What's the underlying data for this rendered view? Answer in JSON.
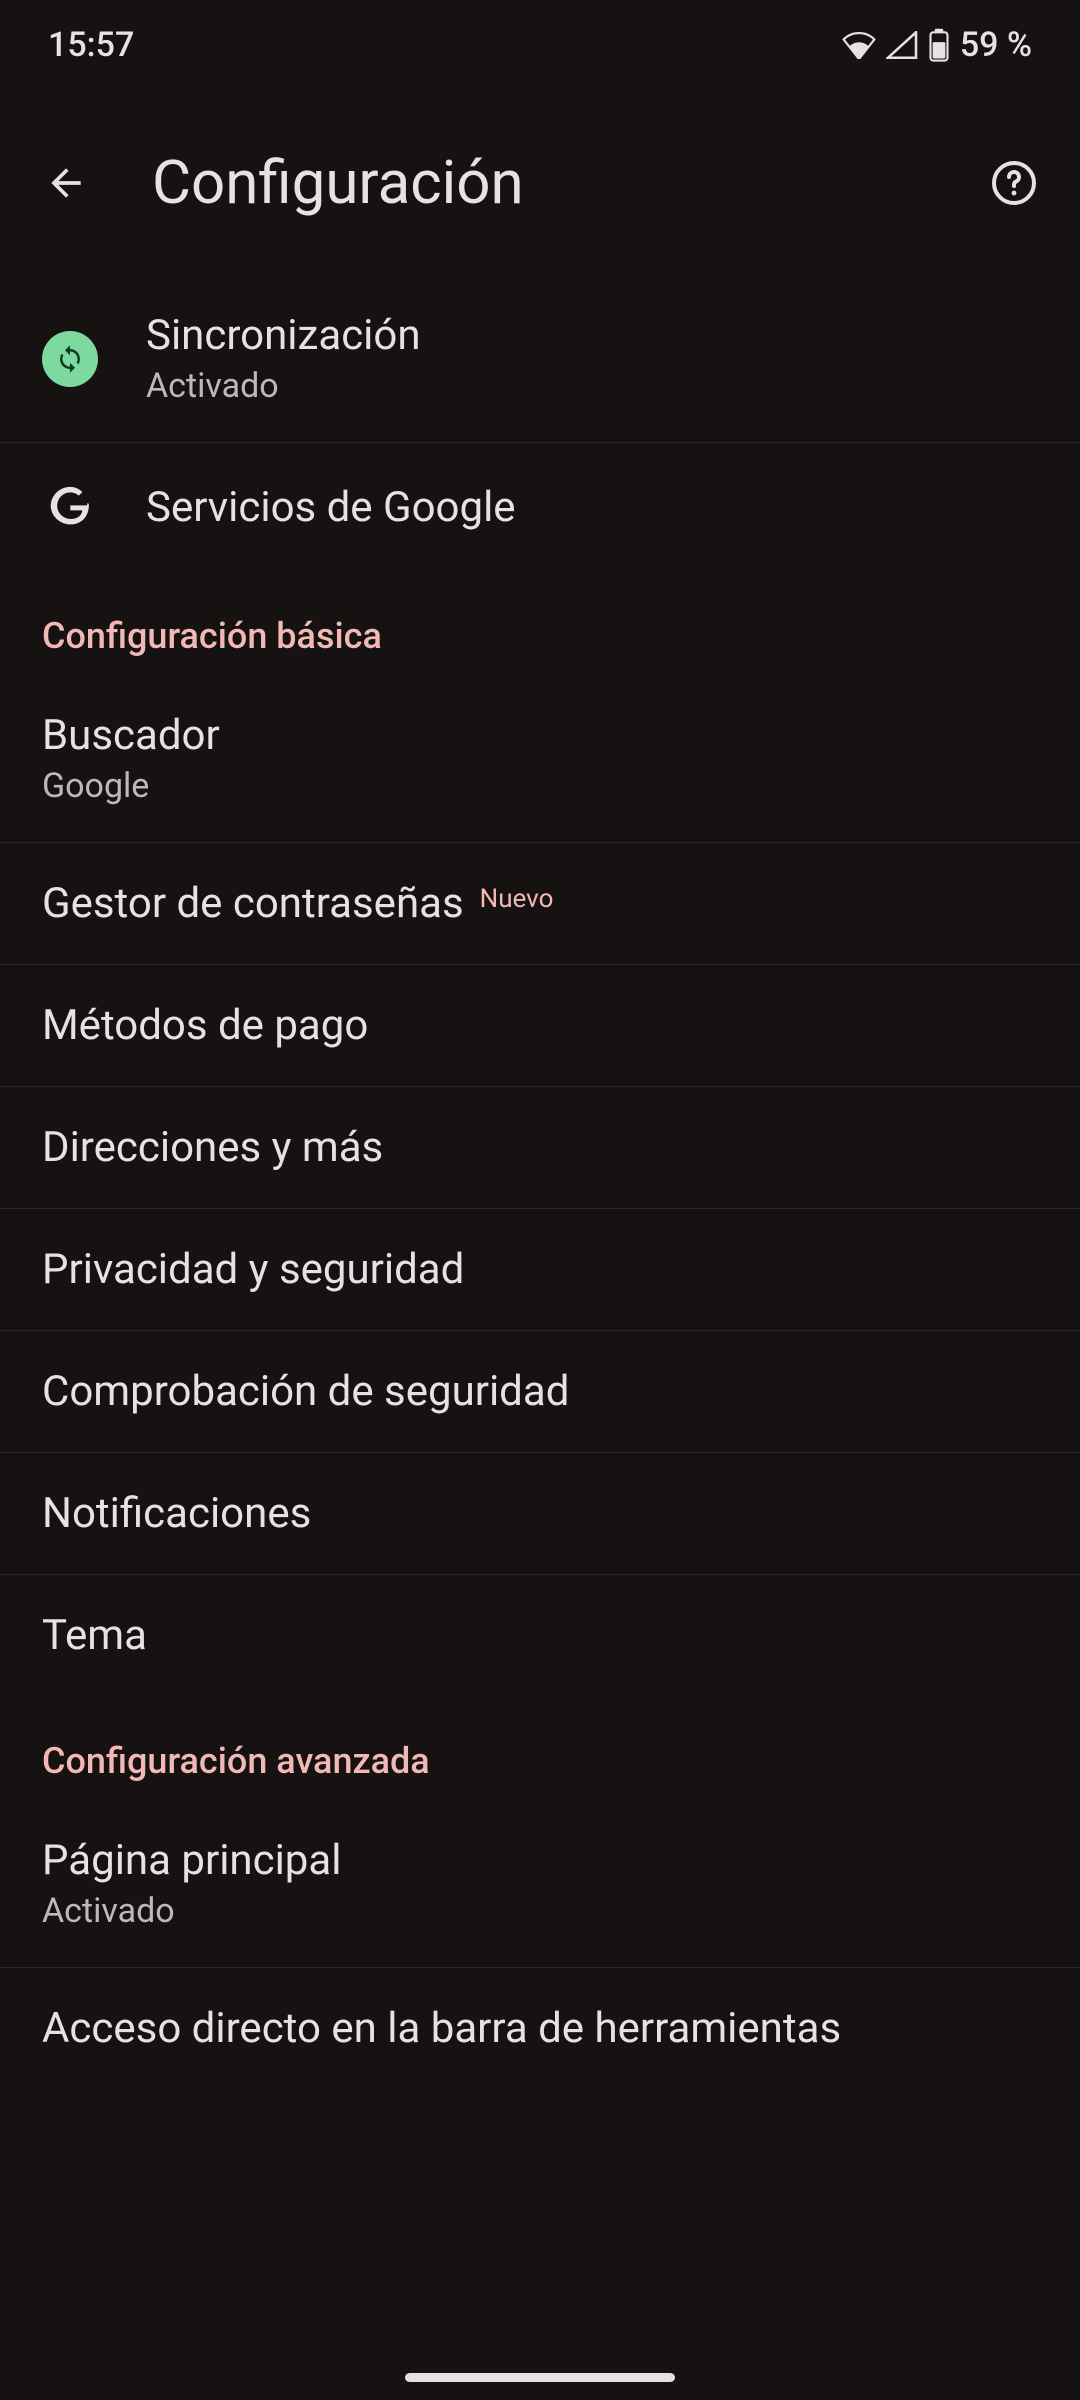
{
  "status": {
    "time": "15:57",
    "battery": "59 %"
  },
  "header": {
    "title": "Configuración"
  },
  "sync": {
    "title": "Sincronización",
    "subtitle": "Activado"
  },
  "google_services": {
    "title": "Servicios de Google"
  },
  "sections": {
    "basic": "Configuración básica",
    "advanced": "Configuración avanzada"
  },
  "items": {
    "search_engine": {
      "title": "Buscador",
      "subtitle": "Google"
    },
    "passwords": {
      "title": "Gestor de contraseñas",
      "badge": "Nuevo"
    },
    "payment": {
      "title": "Métodos de pago"
    },
    "addresses": {
      "title": "Direcciones y más"
    },
    "privacy": {
      "title": "Privacidad y seguridad"
    },
    "safety_check": {
      "title": "Comprobación de seguridad"
    },
    "notifications": {
      "title": "Notificaciones"
    },
    "theme": {
      "title": "Tema"
    },
    "homepage": {
      "title": "Página principal",
      "subtitle": "Activado"
    },
    "toolbar_shortcut": {
      "title": "Acceso directo en la barra de herramientas"
    }
  }
}
